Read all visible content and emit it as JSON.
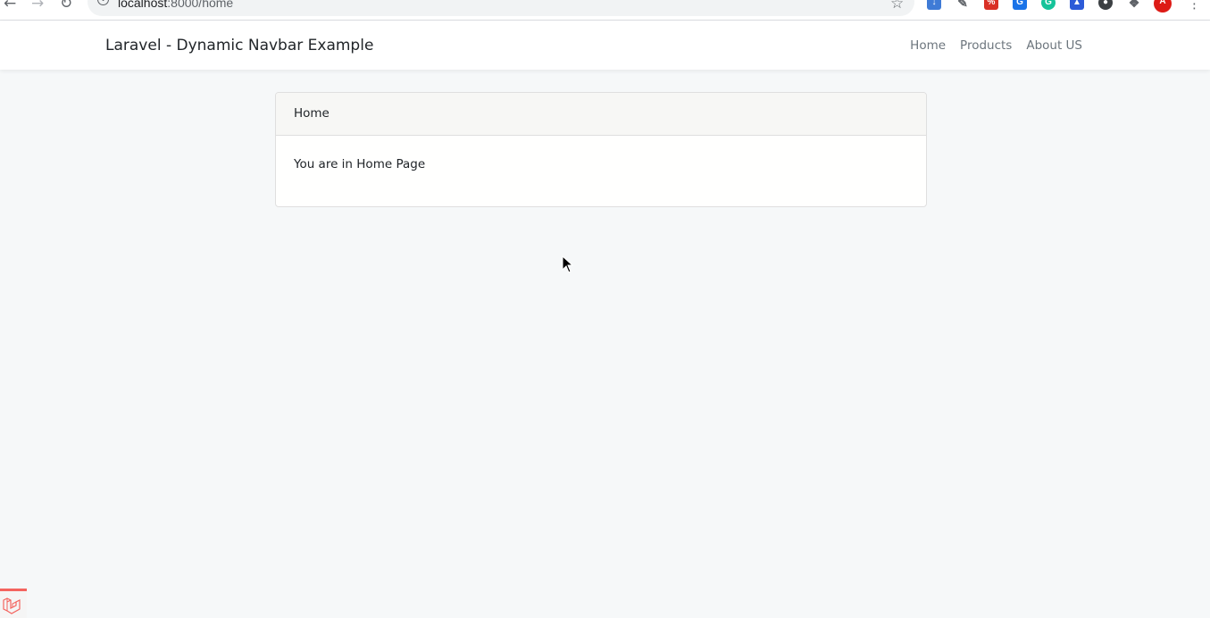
{
  "browser": {
    "url_host": "localhost",
    "url_path": ":8000/home",
    "back_icon": "arrow-left-icon",
    "forward_icon": "arrow-right-icon",
    "reload_icon": "reload-icon",
    "info_icon": "info-icon",
    "bookmark_icon": "star-icon"
  },
  "navbar": {
    "brand": "Laravel - Dynamic Navbar Example",
    "links": [
      "Home",
      "Products",
      "About US"
    ]
  },
  "card": {
    "header": "Home",
    "body": "You are in Home Page"
  },
  "colors": {
    "page_bg": "#f6f8f9",
    "navbar_bg": "#ffffff",
    "link": "#6c757d",
    "laravel_red": "#f4645f"
  }
}
